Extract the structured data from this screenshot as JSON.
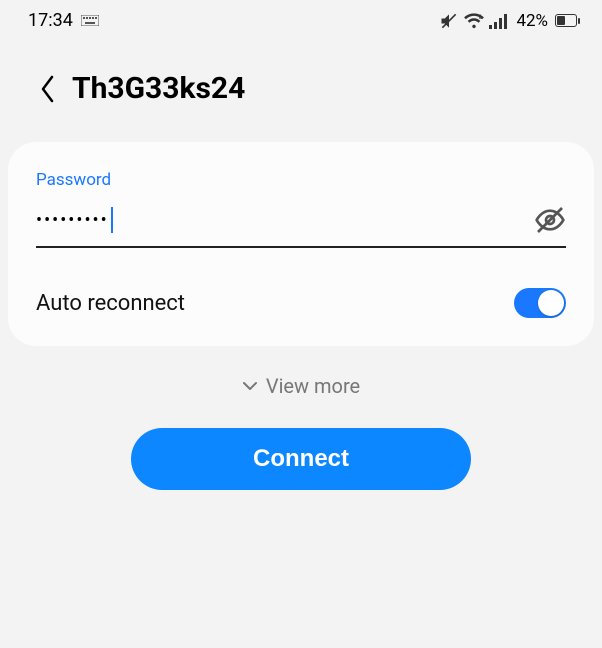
{
  "status": {
    "time": "17:34",
    "battery_text": "42%"
  },
  "header": {
    "title": "Th3G33ks24"
  },
  "form": {
    "password_label": "Password",
    "password_masked": "•••••••••",
    "auto_reconnect_label": "Auto reconnect",
    "auto_reconnect_on": true
  },
  "viewmore": {
    "label": "View more"
  },
  "actions": {
    "connect_label": "Connect"
  }
}
